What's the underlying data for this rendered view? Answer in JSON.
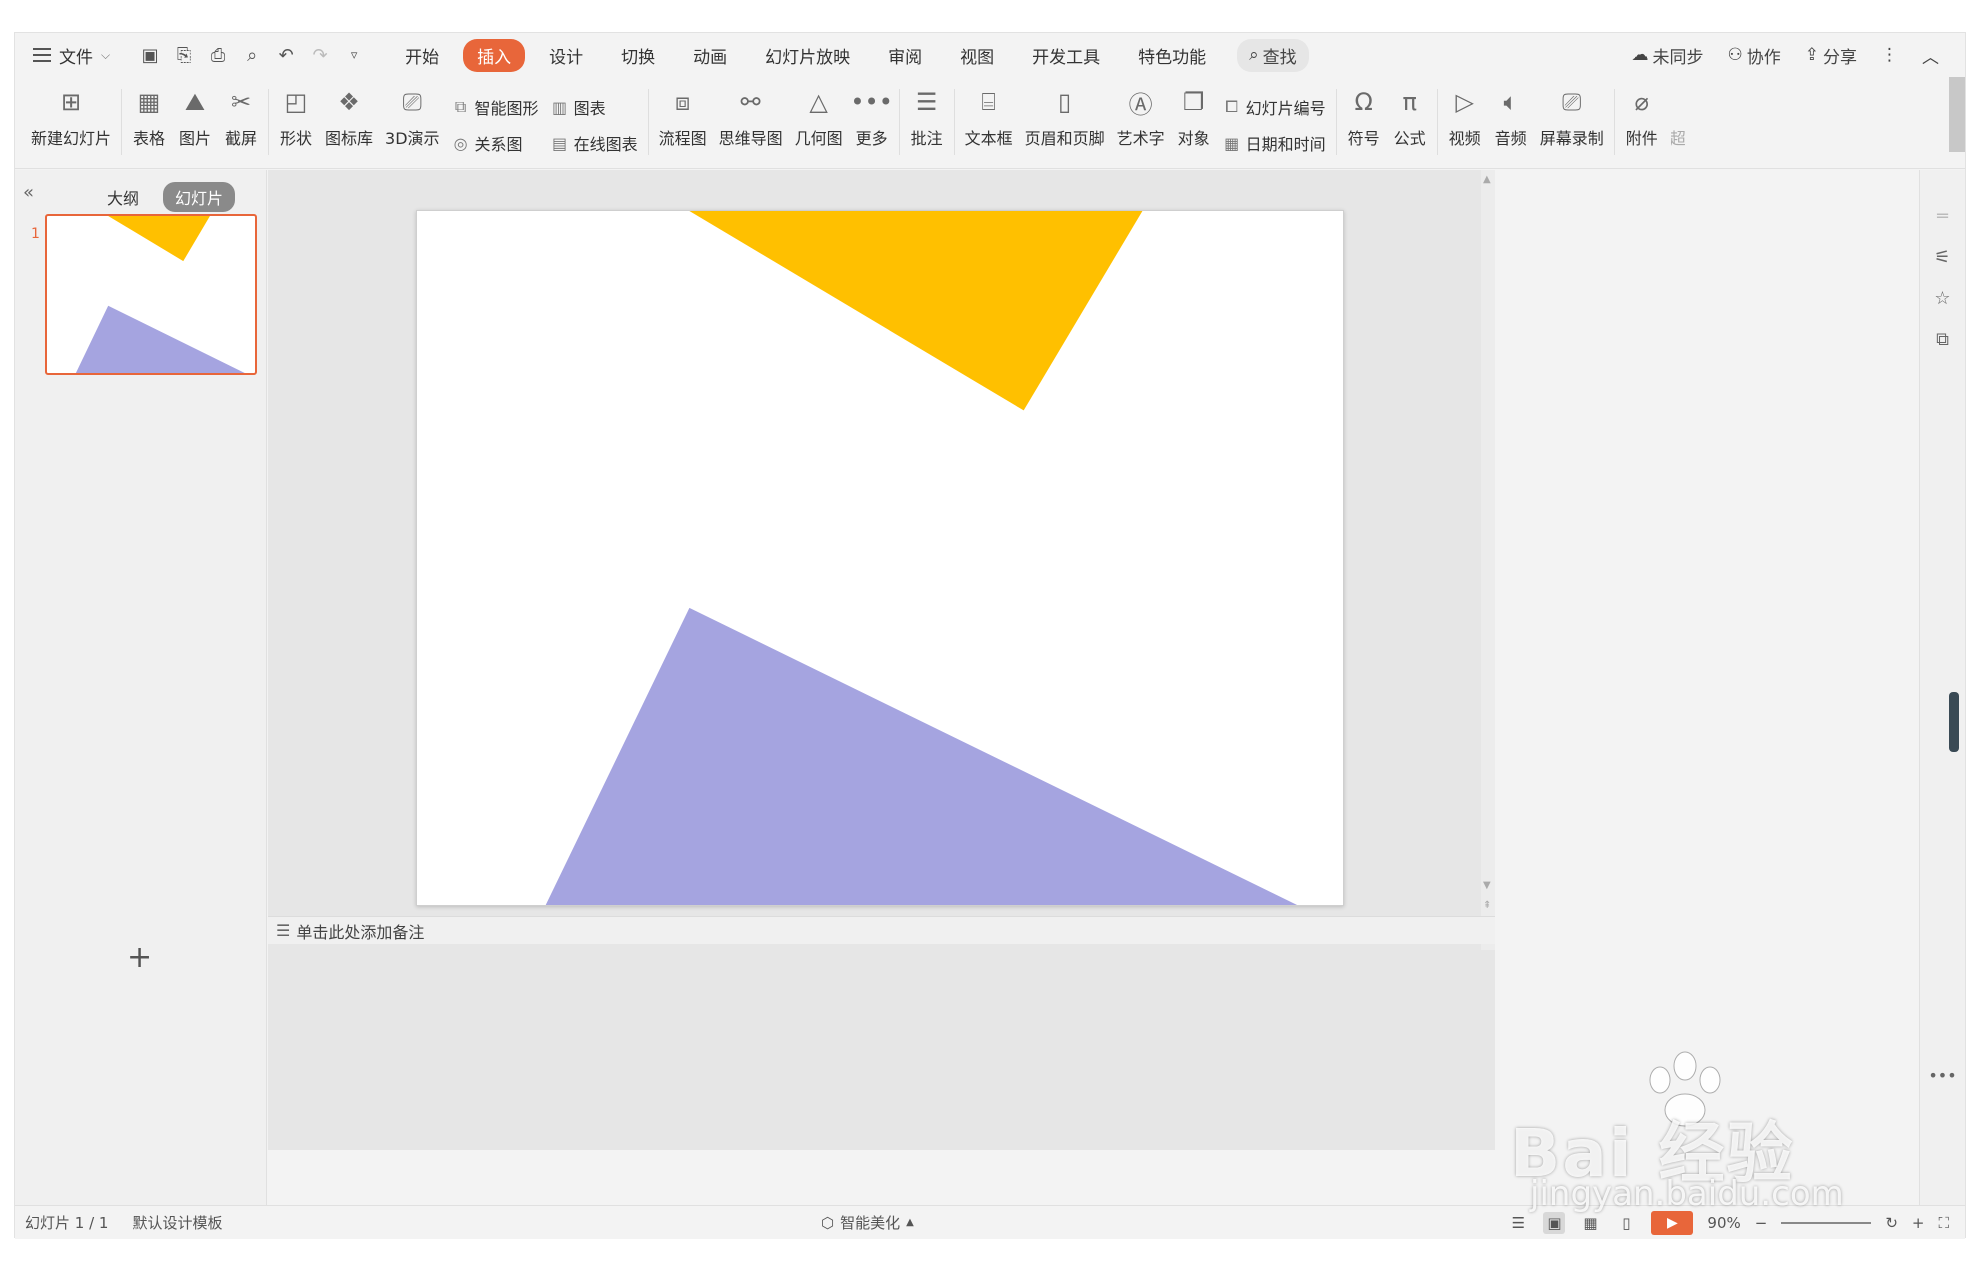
{
  "colors": {
    "accent": "#e8663a",
    "shape_yellow": "#ffc000",
    "shape_purple": "#a5a4e0"
  },
  "menu": {
    "file": "文件",
    "tabs": [
      "开始",
      "插入",
      "设计",
      "切换",
      "动画",
      "幻灯片放映",
      "审阅",
      "视图",
      "开发工具",
      "特色功能"
    ],
    "active_tab": "插入",
    "search": "查找",
    "right": {
      "sync": "未同步",
      "collab": "协作",
      "share": "分享"
    }
  },
  "ribbon": {
    "new_slide": "新建幻灯片",
    "table": "表格",
    "image": "图片",
    "screenshot": "截屏",
    "shape": "形状",
    "icon_lib": "图标库",
    "demo3d": "3D演示",
    "smart_shape": "智能图形",
    "chart": "图表",
    "relation": "关系图",
    "online_chart": "在线图表",
    "flowchart": "流程图",
    "mindmap": "思维导图",
    "geometry": "几何图",
    "more": "更多",
    "comment": "批注",
    "textbox": "文本框",
    "header_footer": "页眉和页脚",
    "art_text": "艺术字",
    "object": "对象",
    "slide_number": "幻灯片编号",
    "datetime": "日期和时间",
    "symbol": "符号",
    "formula": "公式",
    "video": "视频",
    "audio": "音频",
    "screen_record": "屏幕录制",
    "attachment": "附件",
    "hyperlink_partial": "超"
  },
  "left_panel": {
    "tab_outline": "大纲",
    "tab_slides": "幻灯片",
    "slide_number": "1"
  },
  "notes": {
    "placeholder": "单击此处添加备注"
  },
  "status": {
    "slide_count": "幻灯片 1 / 1",
    "template": "默认设计模板",
    "beautify": "智能美化",
    "zoom": "90%"
  },
  "watermark": {
    "main": "Bai 经验",
    "sub": "jingyan.baidu.com"
  }
}
